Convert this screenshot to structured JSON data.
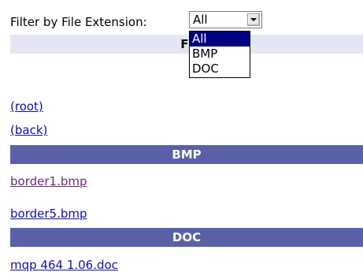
{
  "filter": {
    "label": "Filter by File Extension:",
    "selected": "All",
    "options": [
      "All",
      "BMP",
      "DOC"
    ]
  },
  "table": {
    "header_partial": "Fi"
  },
  "nav": {
    "root": "(root)",
    "back": "(back)"
  },
  "groups": [
    {
      "name": "BMP",
      "files": [
        "border1.bmp",
        "border5.bmp"
      ]
    },
    {
      "name": "DOC",
      "files": [
        "mqp 464 1.06.doc"
      ]
    }
  ],
  "colors": {
    "group_header": "#5a60a8",
    "link": "#1010a8",
    "visited_link": "#6a2a7a"
  }
}
